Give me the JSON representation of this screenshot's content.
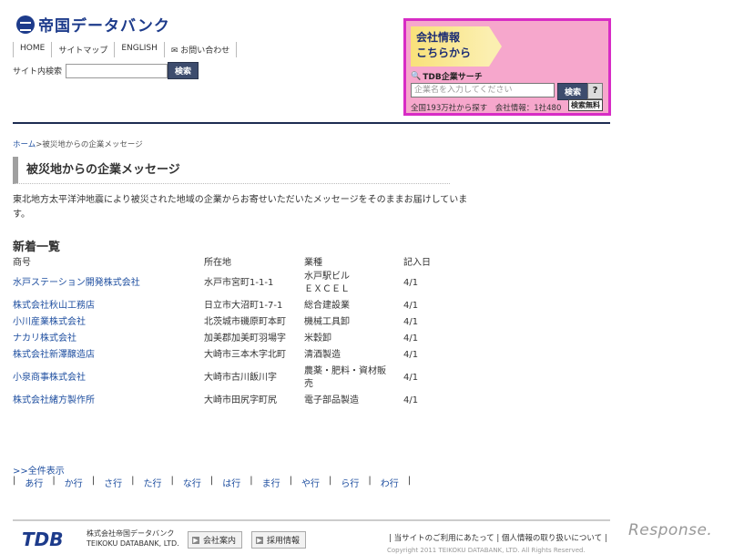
{
  "header": {
    "logo_text": "帝国データバンク",
    "nav": [
      "HOME",
      "サイトマップ",
      "ENGLISH",
      "お問い合わせ"
    ],
    "site_search_label": "サイト内検索",
    "site_search_button": "検索"
  },
  "company_search": {
    "title_line1": "会社情報",
    "title_line2": "こちらから",
    "label": "TDB企業サーチ",
    "placeholder": "企業名を入力してください",
    "button": "検索",
    "help": "?",
    "footer": "全国193万社から探す　会社情報：1社480",
    "badge": "検索無料"
  },
  "breadcrumb": {
    "home": "ホーム",
    "sep": ">",
    "current": "被災地からの企業メッセージ"
  },
  "page_title": "被災地からの企業メッセージ",
  "intro": "東北地方太平洋沖地震により被災された地域の企業からお寄せいただいたメッセージをそのままお届けしています。",
  "list": {
    "heading": "新着一覧",
    "columns": [
      "商号",
      "所在地",
      "業種",
      "記入日"
    ],
    "rows": [
      {
        "name": "水戸ステーション開発株式会社",
        "location": "水戸市宮町1-1-1",
        "industry": "水戸駅ビル\nＥＸＣＥＬ",
        "date": "4/1"
      },
      {
        "name": "株式会社秋山工務店",
        "location": "日立市大沼町1-7-1",
        "industry": "総合建設業",
        "date": "4/1"
      },
      {
        "name": "小川産業株式会社",
        "location": "北茨城市磯原町本町",
        "industry": "機械工具卸",
        "date": "4/1"
      },
      {
        "name": "ナカリ株式会社",
        "location": "加美郡加美町羽場字",
        "industry": "米穀卸",
        "date": "4/1"
      },
      {
        "name": "株式会社新澤醸造店",
        "location": "大崎市三本木字北町",
        "industry": "清酒製造",
        "date": "4/1"
      },
      {
        "name": "小泉商事株式会社",
        "location": "大崎市古川飯川字",
        "industry": "農薬・肥料・資材販\n売",
        "date": "4/1"
      },
      {
        "name": "株式会社緒方製作所",
        "location": "大崎市田尻字町尻",
        "industry": "電子部品製造",
        "date": "4/1"
      }
    ]
  },
  "show_all": ">>全件表示",
  "kana_index": [
    "あ行",
    "か行",
    "さ行",
    "た行",
    "な行",
    "は行",
    "ま行",
    "や行",
    "ら行",
    "わ行"
  ],
  "footer": {
    "logo": "TDB",
    "company_jp": "株式会社帝国データバンク",
    "company_en": "TEIKOKU DATABANK, LTD.",
    "btn_about": "会社案内",
    "btn_recruit": "採用情報",
    "links": "| 当サイトのご利用にあたって | 個人情報の取り扱いについて |",
    "copyright": "Copyright 2011 TEIKOKU DATABANK, LTD. All Rights Reserved."
  },
  "watermark": "Response."
}
